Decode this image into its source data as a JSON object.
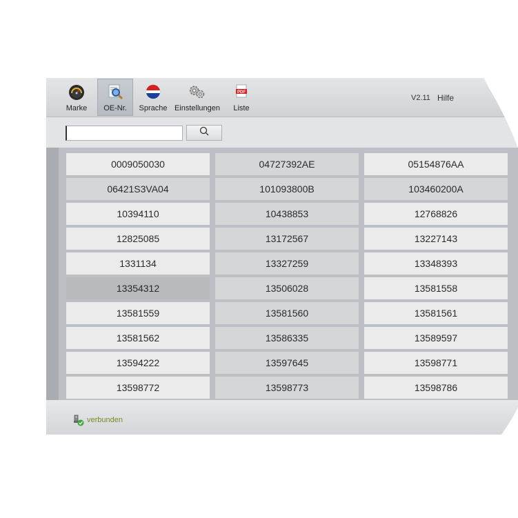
{
  "toolbar": {
    "buttons": [
      {
        "label": "Marke",
        "icon": "speedometer-icon"
      },
      {
        "label": "OE-Nr.",
        "icon": "magnifier-search-icon"
      },
      {
        "label": "Sprache",
        "icon": "language-flag-icon"
      },
      {
        "label": "Einstellungen",
        "icon": "gears-icon"
      },
      {
        "label": "Liste",
        "icon": "pdf-icon"
      }
    ],
    "active": "OE-Nr.",
    "version": "V2.11",
    "help": "Hilfe"
  },
  "search": {
    "value": "",
    "button_icon": "search-icon"
  },
  "grid": {
    "rows": [
      [
        "0009050030",
        "04727392AE",
        "05154876AA"
      ],
      [
        "06421S3VA04",
        "101093800B",
        "103460200A"
      ],
      [
        "10394110",
        "10438853",
        "12768826"
      ],
      [
        "12825085",
        "13172567",
        "13227143"
      ],
      [
        "1331134",
        "13327259",
        "13348393"
      ],
      [
        "13354312",
        "13506028",
        "13581558"
      ],
      [
        "13581559",
        "13581560",
        "13581561"
      ],
      [
        "13581562",
        "13586335",
        "13589597"
      ],
      [
        "13594222",
        "13597645",
        "13598771"
      ],
      [
        "13598772",
        "13598773",
        "13598786"
      ]
    ],
    "selected": "13354312"
  },
  "status": {
    "text": "verbunden",
    "icon": "usb-connected-icon"
  },
  "colors": {
    "status_text": "#7a8a2a",
    "toolbar_bg": "#d8dadd",
    "grid_bg": "#bcbfc4"
  }
}
